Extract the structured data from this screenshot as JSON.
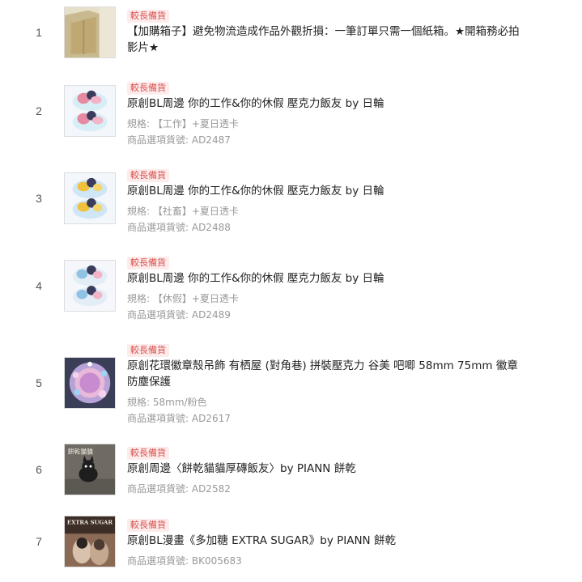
{
  "accent_color": "#d9534f",
  "badge_bg": "#fdecec",
  "items": [
    {
      "index": "1",
      "badge": "較長備貨",
      "title": "【加購箱子】避免物流造成作品外觀折損：一筆訂單只需一個紙箱。★開箱務必拍影片★",
      "thumb_icon": "cardboard-box-photo"
    },
    {
      "index": "2",
      "badge": "較長備貨",
      "title": "原創BL周邊 你的工作&你的休假 壓克力飯友 by 日輪",
      "spec": "規格: 【工作】+夏日透卡",
      "sku": "商品選項貨號: AD2487",
      "thumb_icon": "acrylic-figure-photo"
    },
    {
      "index": "3",
      "badge": "較長備貨",
      "title": "原創BL周邊 你的工作&你的休假 壓克力飯友 by 日輪",
      "spec": "規格: 【社畜】+夏日透卡",
      "sku": "商品選項貨號: AD2488",
      "thumb_icon": "acrylic-figure-photo"
    },
    {
      "index": "4",
      "badge": "較長備貨",
      "title": "原創BL周邊 你的工作&你的休假 壓克力飯友 by 日輪",
      "spec": "規格: 【休假】+夏日透卡",
      "sku": "商品選項貨號: AD2489",
      "thumb_icon": "acrylic-figure-photo"
    },
    {
      "index": "5",
      "badge": "較長備貨",
      "title": "原創花環徽章殼吊飾 有栖屋 (對角巷) 拼裝壓克力 谷美 吧唧 58mm 75mm 徽章防塵保護",
      "spec": "規格: 58mm/粉色",
      "sku": "商品選項貨號: AD2617",
      "thumb_icon": "badge-wreath-photo"
    },
    {
      "index": "6",
      "badge": "較長備貨",
      "title": "原創周邊〈餅乾貓貓厚磚飯友〉by PIANN 餅乾",
      "sku": "商品選項貨號: AD2582",
      "thumb_icon": "cookie-cat-photo",
      "thumb_text": "餅乾貓貓"
    },
    {
      "index": "7",
      "badge": "較長備貨",
      "title": "原創BL漫畫《多加糖 EXTRA SUGAR》by PIANN 餅乾",
      "sku": "商品選項貨號: BK005683",
      "thumb_icon": "comic-cover-photo",
      "thumb_text": "EXTRA SUGAR"
    }
  ]
}
